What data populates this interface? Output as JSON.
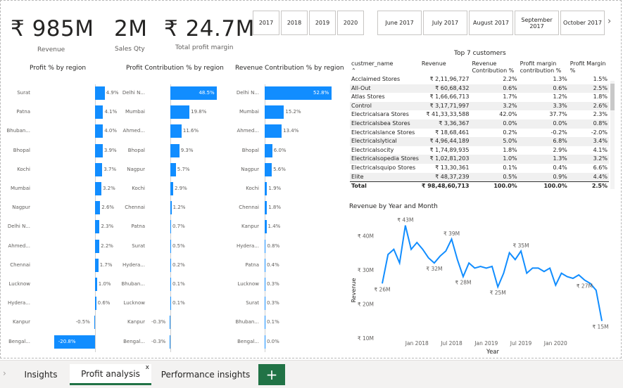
{
  "kpis": [
    {
      "value": "₹ 985M",
      "label": "Revenue"
    },
    {
      "value": "2M",
      "label": "Sales Qty"
    },
    {
      "value": "₹ 24.7M",
      "label": "Total profit margin"
    }
  ],
  "year_slicer": [
    "2017",
    "2018",
    "2019",
    "2020"
  ],
  "month_slicer": [
    "June 2017",
    "July 2017",
    "August 2017",
    "September 2017",
    "October 2017"
  ],
  "month_slicer_next": "›",
  "profit_pct_chart": {
    "title": "Profit % by region",
    "rows": [
      {
        "label": "Surat",
        "value": "4.9%"
      },
      {
        "label": "Patna",
        "value": "4.1%"
      },
      {
        "label": "Bhuban...",
        "value": "4.0%"
      },
      {
        "label": "Bhopal",
        "value": "3.9%"
      },
      {
        "label": "Kochi",
        "value": "3.7%"
      },
      {
        "label": "Mumbai",
        "value": "3.2%"
      },
      {
        "label": "Nagpur",
        "value": "2.6%"
      },
      {
        "label": "Delhi N...",
        "value": "2.3%"
      },
      {
        "label": "Ahmed...",
        "value": "2.2%"
      },
      {
        "label": "Chennai",
        "value": "1.7%"
      },
      {
        "label": "Lucknow",
        "value": "1.0%"
      },
      {
        "label": "Hydera...",
        "value": "0.6%"
      },
      {
        "label": "Kanpur",
        "value": "-0.5%"
      },
      {
        "label": "Bengal...",
        "value": "-20.8%"
      }
    ]
  },
  "profit_contrib_chart": {
    "title": "Profit Contribution % by region",
    "rows": [
      {
        "label": "Delhi N...",
        "value": "48.5%"
      },
      {
        "label": "Mumbai",
        "value": "19.8%"
      },
      {
        "label": "Ahmed...",
        "value": "11.6%"
      },
      {
        "label": "Bhopal",
        "value": "9.3%"
      },
      {
        "label": "Nagpur",
        "value": "5.7%"
      },
      {
        "label": "Kochi",
        "value": "2.9%"
      },
      {
        "label": "Chennai",
        "value": "1.2%"
      },
      {
        "label": "Patna",
        "value": "0.7%"
      },
      {
        "label": "Surat",
        "value": "0.5%"
      },
      {
        "label": "Hydera...",
        "value": "0.2%"
      },
      {
        "label": "Bhuban...",
        "value": "0.1%"
      },
      {
        "label": "Lucknow",
        "value": "0.1%"
      },
      {
        "label": "Kanpur",
        "value": "-0.3%"
      },
      {
        "label": "Bengal...",
        "value": "-0.3%"
      }
    ]
  },
  "revenue_contrib_chart": {
    "title": "Revenue Contribution % by region",
    "rows": [
      {
        "label": "Delhi N...",
        "value": "52.8%"
      },
      {
        "label": "Mumbai",
        "value": "15.2%"
      },
      {
        "label": "Ahmed...",
        "value": "13.4%"
      },
      {
        "label": "Bhopal",
        "value": "6.0%"
      },
      {
        "label": "Nagpur",
        "value": "5.6%"
      },
      {
        "label": "Kochi",
        "value": "1.9%"
      },
      {
        "label": "Chennai",
        "value": "1.8%"
      },
      {
        "label": "Kanpur",
        "value": "1.4%"
      },
      {
        "label": "Hydera...",
        "value": "0.8%"
      },
      {
        "label": "Patna",
        "value": "0.4%"
      },
      {
        "label": "Lucknow",
        "value": "0.3%"
      },
      {
        "label": "Surat",
        "value": "0.3%"
      },
      {
        "label": "Bhuban...",
        "value": "0.1%"
      },
      {
        "label": "Bengal...",
        "value": "0.0%"
      }
    ]
  },
  "customers_table": {
    "title": "Top 7 customers",
    "headers": [
      "custmer_name",
      "Revenue",
      "Revenue Contribution %",
      "Profit margin contribution %",
      "Profit Margin %"
    ],
    "sort_indicator": "⌃",
    "rows": [
      [
        "Acclaimed Stores",
        "₹ 2,11,96,727",
        "2.2%",
        "1.3%",
        "1.5%"
      ],
      [
        "All-Out",
        "₹ 60,68,432",
        "0.6%",
        "0.6%",
        "2.5%"
      ],
      [
        "Atlas Stores",
        "₹ 1,66,66,713",
        "1.7%",
        "1.2%",
        "1.8%"
      ],
      [
        "Control",
        "₹ 3,17,71,997",
        "3.2%",
        "3.3%",
        "2.6%"
      ],
      [
        "Electricalsara Stores",
        "₹ 41,33,33,588",
        "42.0%",
        "37.7%",
        "2.3%"
      ],
      [
        "Electricalsbea Stores",
        "₹ 3,36,367",
        "0.0%",
        "0.0%",
        "0.8%"
      ],
      [
        "Electricalslance Stores",
        "₹ 18,68,461",
        "0.2%",
        "-0.2%",
        "-2.0%"
      ],
      [
        "Electricalslytical",
        "₹ 4,96,44,189",
        "5.0%",
        "6.8%",
        "3.4%"
      ],
      [
        "Electricalsocity",
        "₹ 1,74,89,935",
        "1.8%",
        "2.9%",
        "4.1%"
      ],
      [
        "Electricalsopedia Stores",
        "₹ 1,02,81,203",
        "1.0%",
        "1.3%",
        "3.2%"
      ],
      [
        "Electricalsquipo Stores",
        "₹ 13,30,361",
        "0.1%",
        "0.4%",
        "6.6%"
      ],
      [
        "Elite",
        "₹ 48,37,239",
        "0.5%",
        "0.9%",
        "4.4%"
      ]
    ],
    "total": [
      "Total",
      "₹ 98,48,60,713",
      "100.0%",
      "100.0%",
      "2.5%"
    ]
  },
  "chart_data": {
    "type": "line",
    "title": "Revenue by Year and Month",
    "xlabel": "Year",
    "ylabel": "Revenue",
    "x_ticks": [
      "Jan 2018",
      "Jul 2018",
      "Jan 2019",
      "Jul 2019",
      "Jan 2020"
    ],
    "y_ticks": [
      "₹ 40M",
      "₹ 30M",
      "₹ 20M",
      "₹ 10M"
    ],
    "ylim": [
      10,
      45
    ],
    "series": [
      {
        "values": [
          26,
          34.5,
          36,
          32,
          43,
          36,
          38,
          36,
          33.5,
          32,
          34,
          35.5,
          39,
          33,
          28,
          32,
          30.5,
          31,
          30.5,
          31,
          25,
          29,
          35,
          33,
          35.5,
          29,
          30.5,
          30.5,
          29.5,
          30.5,
          25.5,
          29,
          28,
          27.5,
          28.5,
          27,
          26,
          24,
          15
        ]
      }
    ],
    "annotations": [
      {
        "label": "₹ 26M",
        "x_index": 0,
        "value": 26
      },
      {
        "label": "₹ 43M",
        "x_index": 4,
        "value": 43
      },
      {
        "label": "₹ 32M",
        "x_index": 9,
        "value": 32
      },
      {
        "label": "₹ 39M",
        "x_index": 12,
        "value": 39
      },
      {
        "label": "₹ 28M",
        "x_index": 14,
        "value": 28
      },
      {
        "label": "₹ 25M",
        "x_index": 20,
        "value": 25
      },
      {
        "label": "₹ 35M",
        "x_index": 24,
        "value": 35.5
      },
      {
        "label": "₹ 27M",
        "x_index": 35,
        "value": 27
      },
      {
        "label": "₹ 15M",
        "x_index": 38,
        "value": 15
      }
    ],
    "color": "#118dff"
  },
  "tabs": [
    {
      "label": "Insights"
    },
    {
      "label": "Profit analysis",
      "active": true
    },
    {
      "label": "Performance insights"
    }
  ],
  "tab_close": "x",
  "add_tab": "+",
  "tab_nav": "›",
  "bar_color": "#118dff",
  "accent_color": "#217346"
}
